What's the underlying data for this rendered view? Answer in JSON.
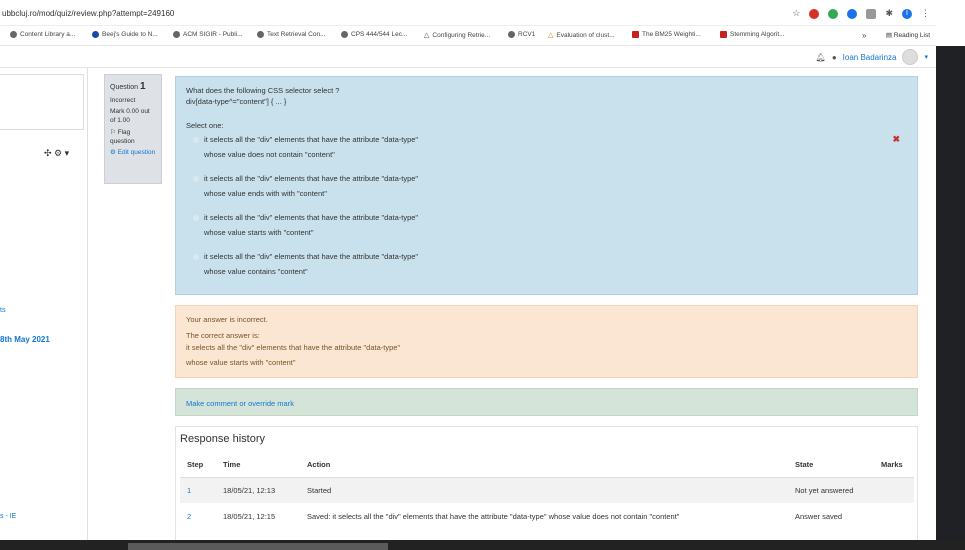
{
  "browser": {
    "url": "ubbcluj.ro/mod/quiz/review.php?attempt=249160",
    "bookmarks": [
      "Content Library a...",
      "Beej's Guide to N...",
      "ACM SIGIR - Publi...",
      "Text Retrieval Con...",
      "CPS 444/544 Lec...",
      "Configuring Retrie...",
      "RCV1",
      "Evaluation of clust...",
      "The BM25 Weighti...",
      "Stemming Algorit..."
    ],
    "overflow": "»",
    "reading_list": "Reading List"
  },
  "header": {
    "user_name": "Ioan Badarinza"
  },
  "drawer": {
    "tools_glyph": "✣ ⚙ ▾",
    "link1": "ts",
    "link2": "8th May 2021",
    "link3": "s - IE"
  },
  "question_info": {
    "label": "Question",
    "number": "1",
    "status": "Incorrect",
    "mark": "Mark 0.00 out of 1.00",
    "flag": "Flag question",
    "edit": "Edit question"
  },
  "question": {
    "text": "What does the following CSS selector select ?",
    "code": "div[data-type^=\"content\"] { ... }",
    "select_one": "Select one:",
    "options": [
      {
        "line1": "it selects all the \"div\" elements that have the attribute \"data-type\"",
        "line2": "whose value does not contain \"content\""
      },
      {
        "line1": "it selects all the \"div\" elements that have the attribute \"data-type\"",
        "line2": "whose value ends with with \"content\""
      },
      {
        "line1": "it selects all the \"div\" elements that have the attribute \"data-type\"",
        "line2": "whose value starts with \"content\""
      },
      {
        "line1": "it selects all the \"div\" elements that have the attribute \"data-type\"",
        "line2": "whose value contains \"content\""
      }
    ],
    "incorrect_mark": "✖"
  },
  "feedback": {
    "result": "Your answer is incorrect.",
    "correct_label": "The correct answer is:",
    "correct_line1": "it selects all the \"div\" elements that have the attribute \"data-type\"",
    "correct_line2": "whose value starts with \"content\""
  },
  "comment_link": "Make comment or override mark",
  "history": {
    "title": "Response history",
    "columns": [
      "Step",
      "Time",
      "Action",
      "State",
      "Marks"
    ],
    "rows": [
      {
        "step": "1",
        "time": "18/05/21, 12:13",
        "action": "Started",
        "state": "Not yet answered",
        "marks": ""
      },
      {
        "step": "2",
        "time": "18/05/21, 12:15",
        "action": "Saved: it selects all the \"div\" elements that have the attribute \"data-type\" whose value does not contain \"content\"",
        "state": "Answer saved",
        "marks": ""
      }
    ]
  }
}
